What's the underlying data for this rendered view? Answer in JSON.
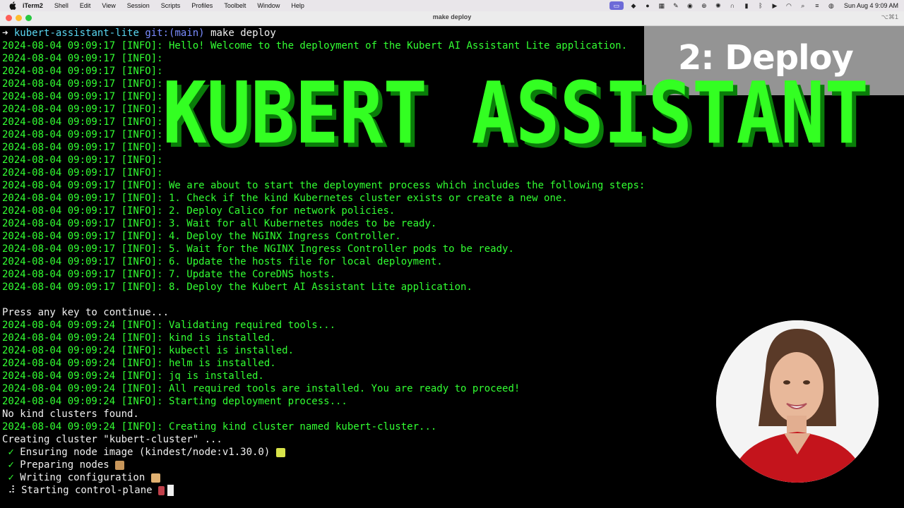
{
  "menubar": {
    "app_name": "iTerm2",
    "items": [
      "Shell",
      "Edit",
      "View",
      "Session",
      "Scripts",
      "Profiles",
      "Toolbelt",
      "Window",
      "Help"
    ],
    "clock": "Sun Aug 4  9:09 AM"
  },
  "window": {
    "title": "make deploy",
    "shortcut": "⌥⌘1"
  },
  "terminal": {
    "prompt_arrow": "➜",
    "prompt_dir": "kubert-assistant-lite",
    "prompt_git": "git:(main)",
    "prompt_cmd": "make deploy",
    "banner_logs": [
      "2024-08-04 09:09:17 [INFO]: Hello! Welcome to the deployment of the Kubert AI Assistant Lite application.",
      "2024-08-04 09:09:17 [INFO]:",
      "2024-08-04 09:09:17 [INFO]:",
      "2024-08-04 09:09:17 [INFO]:",
      "2024-08-04 09:09:17 [INFO]:",
      "2024-08-04 09:09:17 [INFO]:",
      "2024-08-04 09:09:17 [INFO]:",
      "2024-08-04 09:09:17 [INFO]:",
      "2024-08-04 09:09:17 [INFO]:",
      "2024-08-04 09:09:17 [INFO]:",
      "2024-08-04 09:09:17 [INFO]:",
      "2024-08-04 09:09:17 [INFO]: We are about to start the deployment process which includes the following steps:",
      "2024-08-04 09:09:17 [INFO]: 1. Check if the kind Kubernetes cluster exists or create a new one.",
      "2024-08-04 09:09:17 [INFO]: 2. Deploy Calico for network policies.",
      "2024-08-04 09:09:17 [INFO]: 3. Wait for all Kubernetes nodes to be ready.",
      "2024-08-04 09:09:17 [INFO]: 4. Deploy the NGINX Ingress Controller.",
      "2024-08-04 09:09:17 [INFO]: 5. Wait for the NGINX Ingress Controller pods to be ready.",
      "2024-08-04 09:09:17 [INFO]: 6. Update the hosts file for local deployment.",
      "2024-08-04 09:09:17 [INFO]: 7. Update the CoreDNS hosts.",
      "2024-08-04 09:09:17 [INFO]: 8. Deploy the Kubert AI Assistant Lite application."
    ],
    "press_key": "Press any key to continue...",
    "validate_logs": [
      "2024-08-04 09:09:24 [INFO]: Validating required tools...",
      "2024-08-04 09:09:24 [INFO]: kind is installed.",
      "2024-08-04 09:09:24 [INFO]: kubectl is installed.",
      "2024-08-04 09:09:24 [INFO]: helm is installed.",
      "2024-08-04 09:09:24 [INFO]: jq is installed.",
      "2024-08-04 09:09:24 [INFO]: All required tools are installed. You are ready to proceed!",
      "2024-08-04 09:09:24 [INFO]: Starting deployment process..."
    ],
    "no_clusters": "No kind clusters found.",
    "creating_log": "2024-08-04 09:09:24 [INFO]: Creating kind cluster named kubert-cluster...",
    "creating_cluster": "Creating cluster \"kubert-cluster\" ...",
    "steps": [
      {
        "mark": " ✓",
        "text": " Ensuring node image (kindest/node:v1.30.0)",
        "emoji_color": "#d8e34a"
      },
      {
        "mark": " ✓",
        "text": " Preparing nodes",
        "emoji_color": "#c8965a"
      },
      {
        "mark": " ✓",
        "text": " Writing configuration",
        "emoji_color": "#e0b070"
      },
      {
        "mark": " ⠼",
        "text": " Starting control-plane",
        "emoji_color": "#c0404a"
      }
    ]
  },
  "overlay": {
    "section_label": "2: Deploy",
    "banner_text": "KUBERT ASSISTANT",
    "banner_color": "#33ff22"
  }
}
